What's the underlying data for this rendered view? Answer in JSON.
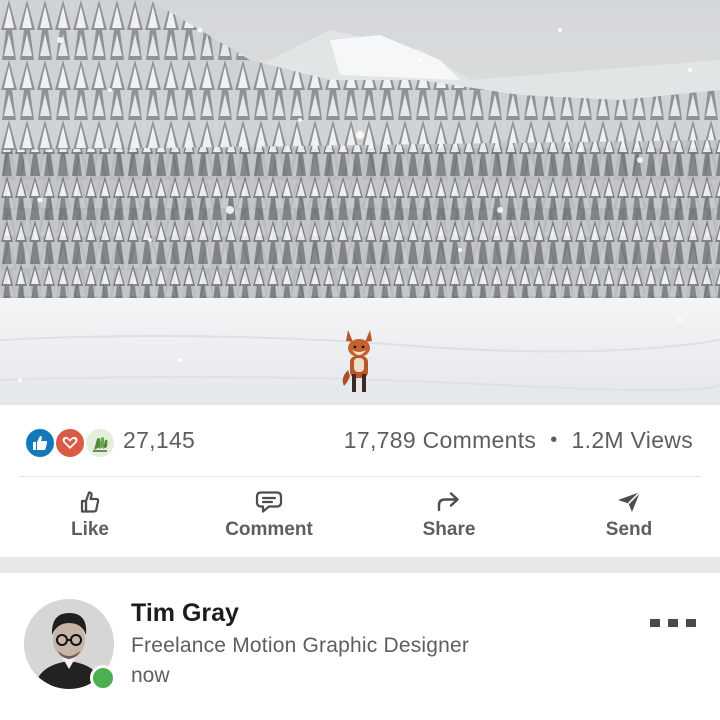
{
  "post": {
    "image_alt": "fox in snowy forest",
    "reactions": {
      "icons": [
        "like-icon",
        "love-icon",
        "celebrate-icon"
      ],
      "count": "27,145"
    },
    "comments": "17,789 Comments",
    "separator": "•",
    "views": "1.2M Views"
  },
  "actions": {
    "like": "Like",
    "comment": "Comment",
    "share": "Share",
    "send": "Send"
  },
  "author": {
    "name": "Tim Gray",
    "headline": "Freelance Motion Graphic Designer",
    "time": "now",
    "presence": "online"
  },
  "colors": {
    "like": "#1479b8",
    "love": "#d95b45",
    "celebrate": "#e4efdb",
    "presence": "#4caf50",
    "text_secondary": "#5e5e5e",
    "text_primary": "#1d1d1d"
  }
}
